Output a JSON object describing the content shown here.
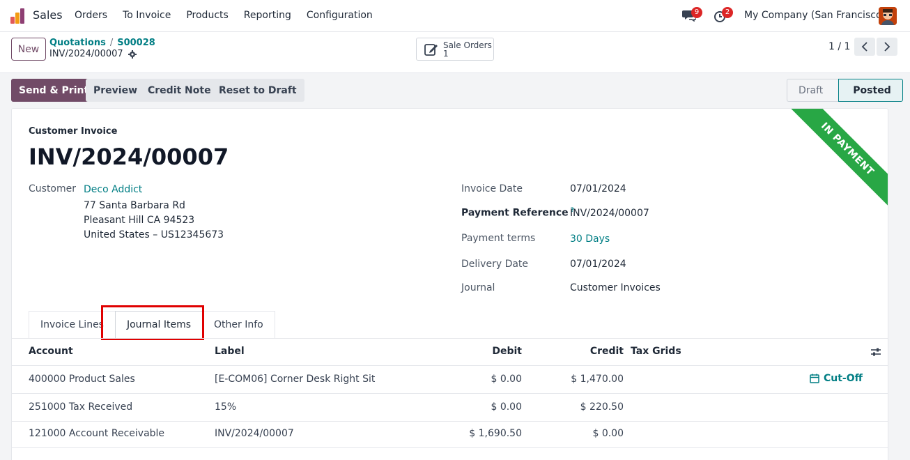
{
  "navbar": {
    "app_name": "Sales",
    "menu": [
      "Orders",
      "To Invoice",
      "Products",
      "Reporting",
      "Configuration"
    ],
    "messages_count": "9",
    "activities_count": "2",
    "company": "My Company (San Francisco)"
  },
  "control": {
    "new_label": "New",
    "breadcrumb": [
      "Quotations",
      "S00028"
    ],
    "record_name": "INV/2024/00007",
    "smart_button": {
      "label": "Sale Orders",
      "count": "1"
    },
    "pager": "1 / 1"
  },
  "actions": {
    "send_print": "Send & Print",
    "preview": "Preview",
    "credit_note": "Credit Note",
    "reset_draft": "Reset to Draft"
  },
  "stages": {
    "draft": "Draft",
    "posted": "Posted"
  },
  "invoice": {
    "ribbon": "IN PAYMENT",
    "type": "Customer Invoice",
    "number": "INV/2024/00007",
    "customer_label": "Customer",
    "customer_name": "Deco Addict",
    "address": [
      "77 Santa Barbara Rd",
      "Pleasant Hill CA 94523",
      "United States – US12345673"
    ],
    "fields": {
      "invoice_date_label": "Invoice Date",
      "invoice_date": "07/01/2024",
      "payment_ref_label": "Payment Reference",
      "payment_ref_help": "?",
      "payment_ref": "INV/2024/00007",
      "payment_terms_label": "Payment terms",
      "payment_terms": "30 Days",
      "delivery_date_label": "Delivery Date",
      "delivery_date": "07/01/2024",
      "journal_label": "Journal",
      "journal": "Customer Invoices"
    }
  },
  "tabs": [
    "Invoice Lines",
    "Journal Items",
    "Other Info"
  ],
  "journal_table": {
    "headers": {
      "account": "Account",
      "label": "Label",
      "debit": "Debit",
      "credit": "Credit",
      "tax_grids": "Tax Grids"
    },
    "rows": [
      {
        "account": "400000 Product Sales",
        "label": "[E-COM06] Corner Desk Right Sit",
        "debit": "$ 0.00",
        "credit": "$ 1,470.00",
        "cutoff": "Cut-Off"
      },
      {
        "account": "251000 Tax Received",
        "label": "15%",
        "debit": "$ 0.00",
        "credit": "$ 220.50"
      },
      {
        "account": "121000 Account Receivable",
        "label": "INV/2024/00007",
        "debit": "$ 1,690.50",
        "credit": "$ 0.00"
      }
    ]
  },
  "colors": {
    "primary": "#714b67",
    "link": "#017e84",
    "ribbon": "#28a745",
    "highlight": "#e00000"
  }
}
